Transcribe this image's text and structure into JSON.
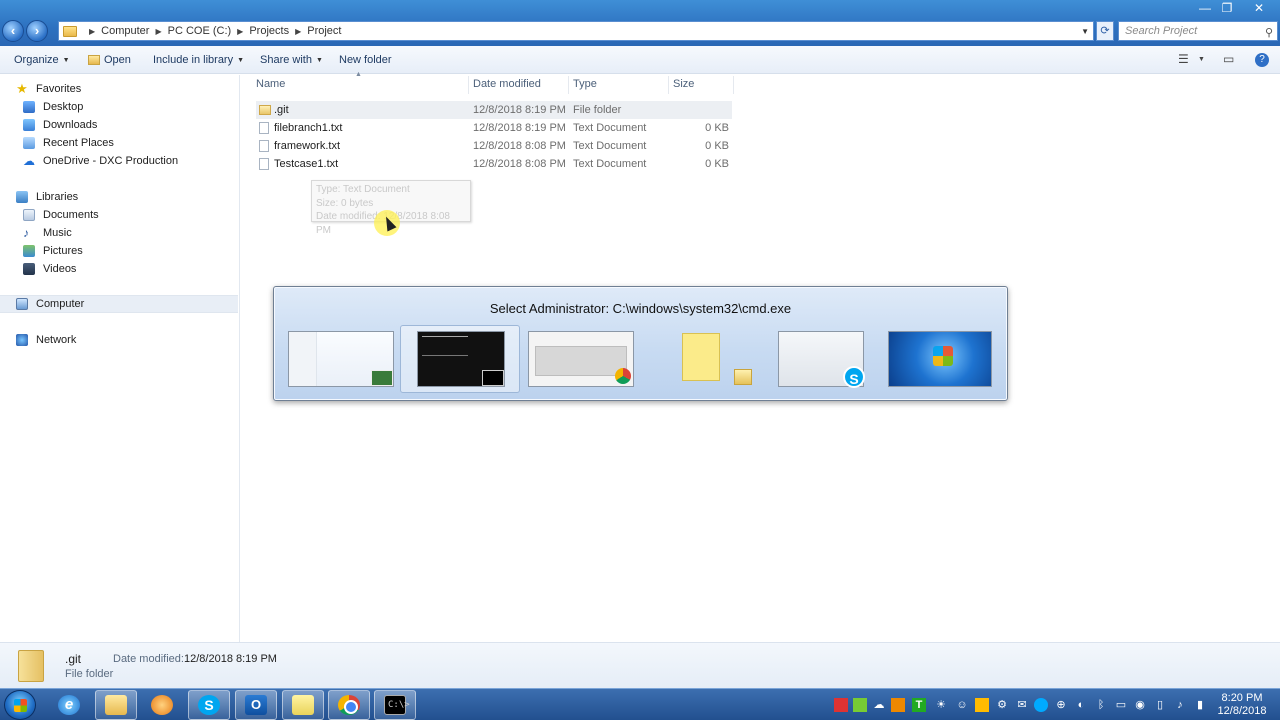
{
  "window": {
    "breadcrumb": [
      "Computer",
      "PC COE (C:)",
      "Projects",
      "Project"
    ],
    "search_placeholder": "Search Project",
    "controls": {
      "min": "—",
      "max": "❐",
      "close": "✕"
    }
  },
  "toolbar": {
    "organize": "Organize",
    "open": "Open",
    "include_in_library": "Include in library",
    "share_with": "Share with",
    "new_folder": "New folder"
  },
  "navpane": {
    "favorites_header": "Favorites",
    "favorites": [
      "Desktop",
      "Downloads",
      "Recent Places",
      "OneDrive - DXC Production"
    ],
    "libraries_header": "Libraries",
    "libraries": [
      "Documents",
      "Music",
      "Pictures",
      "Videos"
    ],
    "computer": "Computer",
    "network": "Network"
  },
  "columns": {
    "name": "Name",
    "date": "Date modified",
    "type": "Type",
    "size": "Size"
  },
  "files": [
    {
      "name": ".git",
      "date": "12/8/2018 8:19 PM",
      "type": "File folder",
      "size": ""
    },
    {
      "name": "filebranch1.txt",
      "date": "12/8/2018 8:19 PM",
      "type": "Text Document",
      "size": "0 KB"
    },
    {
      "name": "framework.txt",
      "date": "12/8/2018 8:08 PM",
      "type": "Text Document",
      "size": "0 KB"
    },
    {
      "name": "Testcase1.txt",
      "date": "12/8/2018 8:08 PM",
      "type": "Text Document",
      "size": "0 KB"
    }
  ],
  "tooltip": {
    "type_line": "Type: Text Document",
    "size_line": "Size: 0 bytes",
    "date_line": "Date modified: 12/8/2018 8:08 PM"
  },
  "switcher": {
    "title": "Select Administrator: C:\\windows\\system32\\cmd.exe"
  },
  "details": {
    "name": ".git",
    "type": "File folder",
    "date_label": "Date modified:",
    "date_value": "12/8/2018 8:19 PM"
  },
  "taskbar": {
    "ie_glyph": "e",
    "skype_glyph": "S",
    "outlook_glyph": "O",
    "cmd_glyph": "C:\\>",
    "time": "8:20 PM",
    "date": "12/8/2018"
  },
  "colors": {
    "titlebar": "#2d71c0",
    "accent": "#1e3a62",
    "selection": "#eceff3"
  }
}
